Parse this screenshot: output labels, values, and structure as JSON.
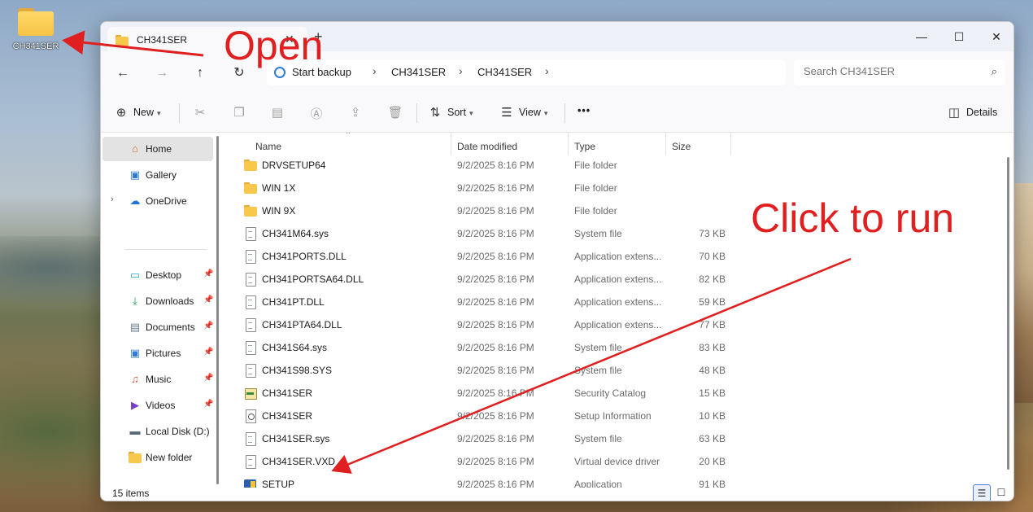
{
  "desktop": {
    "icon_label": "CH341SER"
  },
  "window": {
    "tab_title": "CH341SER",
    "tab_close": "✕",
    "new_tab": "+",
    "minimize": "—",
    "maximize": "☐",
    "close": "✕"
  },
  "nav": {
    "back": "←",
    "forward": "→",
    "up": "↑",
    "refresh": "↻",
    "breadcrumb": [
      "Start backup",
      "CH341SER",
      "CH341SER"
    ],
    "chevron": "›",
    "search_placeholder": "Search CH341SER",
    "search_icon": "⌕"
  },
  "toolbar": {
    "new_label": "New",
    "sort_label": "Sort",
    "view_label": "View",
    "more_label": "•••",
    "details_label": "Details",
    "icons": [
      "cut-icon",
      "copy-icon",
      "paste-icon",
      "rename-icon",
      "share-icon",
      "delete-icon"
    ]
  },
  "sidebar": {
    "items": [
      {
        "label": "Home",
        "icon": "home-icon"
      },
      {
        "label": "Gallery",
        "icon": "gallery-icon"
      },
      {
        "label": "OneDrive",
        "icon": "cloud-icon"
      },
      {
        "label": "Desktop",
        "icon": "desktop-icon"
      },
      {
        "label": "Downloads",
        "icon": "download-icon"
      },
      {
        "label": "Documents",
        "icon": "documents-icon"
      },
      {
        "label": "Pictures",
        "icon": "pictures-icon"
      },
      {
        "label": "Music",
        "icon": "music-icon"
      },
      {
        "label": "Videos",
        "icon": "videos-icon"
      },
      {
        "label": "Local Disk (D:)",
        "icon": "drive-icon"
      },
      {
        "label": "New folder",
        "icon": "folder-icon"
      }
    ]
  },
  "columns": {
    "name": "Name",
    "date": "Date modified",
    "type": "Type",
    "size": "Size"
  },
  "files": [
    {
      "name": "DRVSETUP64",
      "date": "9/2/2025 8:16 PM",
      "type": "File folder",
      "size": "",
      "icon": "folder"
    },
    {
      "name": "WIN 1X",
      "date": "9/2/2025 8:16 PM",
      "type": "File folder",
      "size": "",
      "icon": "folder"
    },
    {
      "name": "WIN 9X",
      "date": "9/2/2025 8:16 PM",
      "type": "File folder",
      "size": "",
      "icon": "folder"
    },
    {
      "name": "CH341M64.sys",
      "date": "9/2/2025 8:16 PM",
      "type": "System file",
      "size": "73 KB",
      "icon": "file"
    },
    {
      "name": "CH341PORTS.DLL",
      "date": "9/2/2025 8:16 PM",
      "type": "Application extens...",
      "size": "70 KB",
      "icon": "file"
    },
    {
      "name": "CH341PORTSA64.DLL",
      "date": "9/2/2025 8:16 PM",
      "type": "Application extens...",
      "size": "82 KB",
      "icon": "file"
    },
    {
      "name": "CH341PT.DLL",
      "date": "9/2/2025 8:16 PM",
      "type": "Application extens...",
      "size": "59 KB",
      "icon": "file"
    },
    {
      "name": "CH341PTA64.DLL",
      "date": "9/2/2025 8:16 PM",
      "type": "Application extens...",
      "size": "77 KB",
      "icon": "file"
    },
    {
      "name": "CH341S64.sys",
      "date": "9/2/2025 8:16 PM",
      "type": "System file",
      "size": "83 KB",
      "icon": "file"
    },
    {
      "name": "CH341S98.SYS",
      "date": "9/2/2025 8:16 PM",
      "type": "System file",
      "size": "48 KB",
      "icon": "file"
    },
    {
      "name": "CH341SER",
      "date": "9/2/2025 8:16 PM",
      "type": "Security Catalog",
      "size": "15 KB",
      "icon": "cat"
    },
    {
      "name": "CH341SER",
      "date": "9/2/2025 8:16 PM",
      "type": "Setup Information",
      "size": "10 KB",
      "icon": "inf"
    },
    {
      "name": "CH341SER.sys",
      "date": "9/2/2025 8:16 PM",
      "type": "System file",
      "size": "63 KB",
      "icon": "file"
    },
    {
      "name": "CH341SER.VXD",
      "date": "9/2/2025 8:16 PM",
      "type": "Virtual device driver",
      "size": "20 KB",
      "icon": "file"
    },
    {
      "name": "SETUP",
      "date": "9/2/2025 8:16 PM",
      "type": "Application",
      "size": "91 KB",
      "icon": "exe"
    }
  ],
  "status": {
    "item_count": "15 items"
  },
  "annotations": {
    "open": "Open",
    "run": "Click to run",
    "color": "#e02020"
  }
}
